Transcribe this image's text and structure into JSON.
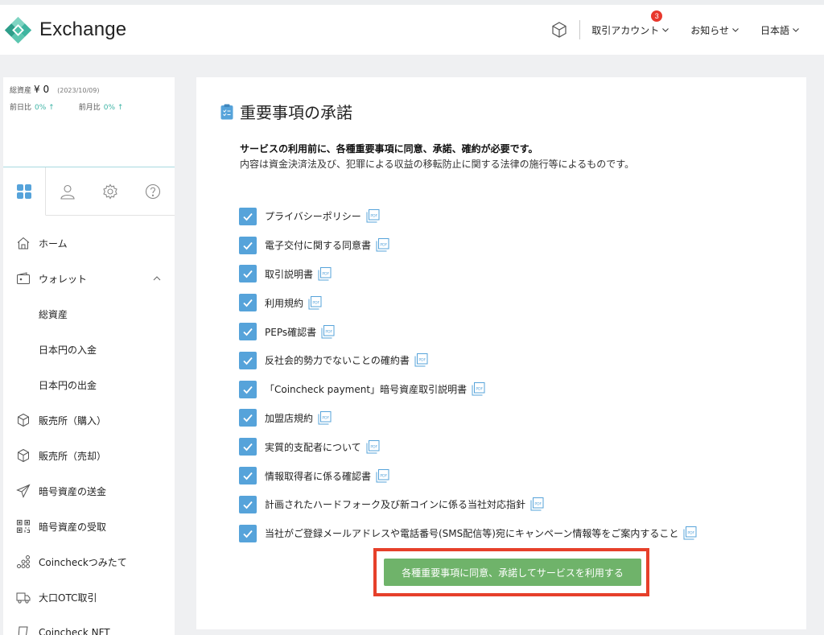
{
  "header": {
    "logo_text": "Exchange",
    "menus": [
      {
        "label": "取引アカウント",
        "badge": "3"
      },
      {
        "label": "お知らせ"
      },
      {
        "label": "日本語"
      }
    ]
  },
  "sidebar": {
    "assets": {
      "label": "総資産",
      "value": "¥ 0",
      "date": "(2023/10/09)",
      "day_label": "前日比",
      "day_value": "0% ↑",
      "month_label": "前月比",
      "month_value": "0% ↑"
    },
    "nav": [
      {
        "label": "ホーム",
        "icon": "home-icon"
      },
      {
        "label": "ウォレット",
        "icon": "wallet-icon",
        "expanded": true
      },
      {
        "label": "総資産",
        "sub": true
      },
      {
        "label": "日本円の入金",
        "sub": true
      },
      {
        "label": "日本円の出金",
        "sub": true
      },
      {
        "label": "販売所（購入）",
        "icon": "cube-icon"
      },
      {
        "label": "販売所（売却）",
        "icon": "cube-icon"
      },
      {
        "label": "暗号資産の送金",
        "icon": "send-icon"
      },
      {
        "label": "暗号資産の受取",
        "icon": "qr-icon"
      },
      {
        "label": "Coincheckつみたて",
        "icon": "coins-icon"
      },
      {
        "label": "大口OTC取引",
        "icon": "truck-icon"
      },
      {
        "label": "Coincheck NFT",
        "icon": "nft-icon"
      }
    ]
  },
  "main": {
    "title": "重要事項の承諾",
    "intro_bold": "サービスの利用前に、各種重要事項に同意、承諾、確約が必要です。",
    "intro_text": "内容は資金決済法及び、犯罪による収益の移転防止に関する法律の施行等によるものです。",
    "items": [
      "プライバシーポリシー",
      "電子交付に関する同意書",
      "取引説明書",
      "利用規約",
      "PEPs確認書",
      "反社会的勢力でないことの確約書",
      "「Coincheck payment」暗号資産取引説明書",
      "加盟店規約",
      "実質的支配者について",
      "情報取得者に係る確認書",
      "計画されたハードフォーク及び新コインに係る当社対応指針",
      "当社がご登録メールアドレスや電話番号(SMS配信等)宛にキャンペーン情報等をご案内すること"
    ],
    "confirm_label": "各種重要事項に同意、承諾してサービスを利用する"
  },
  "colors": {
    "checkbox": "#56a3da",
    "confirm": "#6fb36a",
    "highlight": "#e6402a",
    "logo": "#4bc0a8"
  }
}
